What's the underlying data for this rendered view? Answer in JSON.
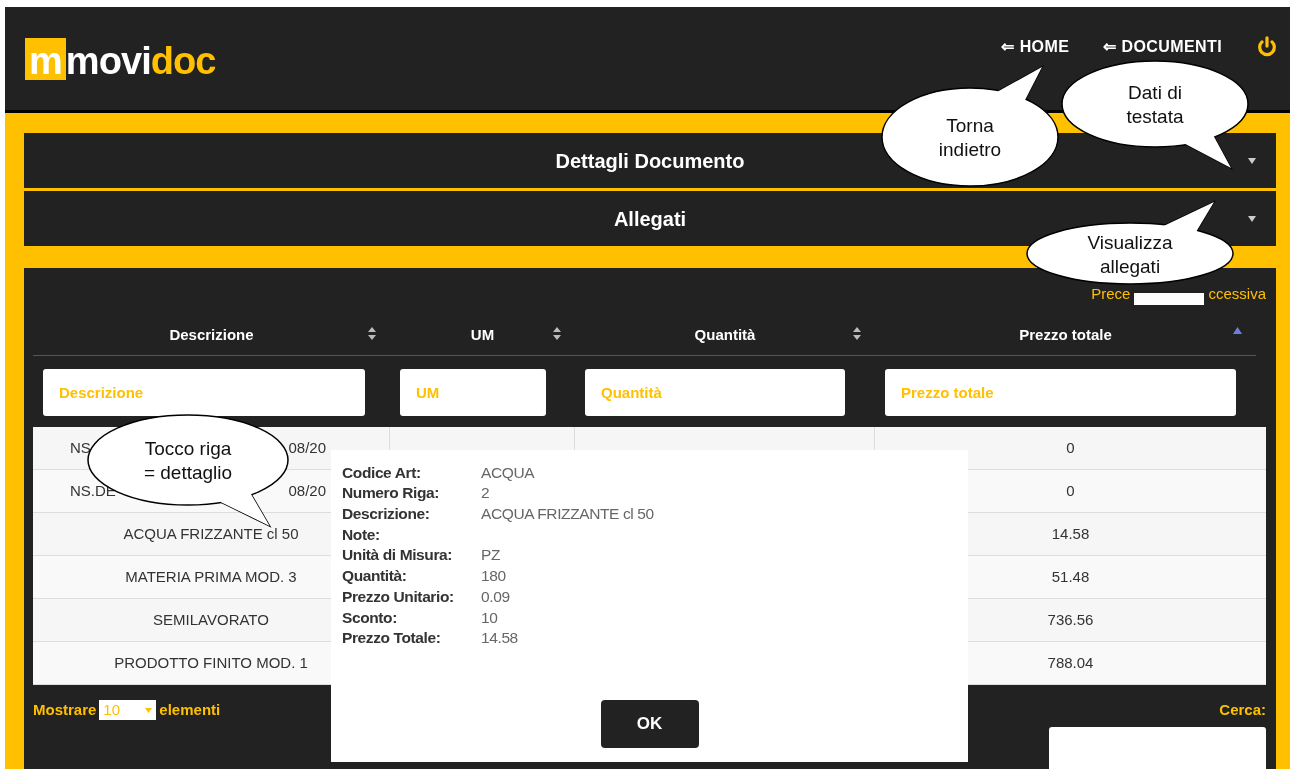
{
  "header": {
    "logo": {
      "mark": "m",
      "part1": "movi",
      "part2": "doc"
    },
    "nav": [
      {
        "kind": "link",
        "label": "⇐ HOME"
      },
      {
        "kind": "link",
        "label": "⇐ DOCUMENTI"
      },
      {
        "kind": "power"
      }
    ]
  },
  "accordions": [
    {
      "title": "Dettagli Documento",
      "expanded": false
    },
    {
      "title": "Allegati",
      "expanded": false
    }
  ],
  "pagination": {
    "previous": "Prece",
    "next": "ccessiva"
  },
  "table": {
    "columns": [
      {
        "label": "Descrizione",
        "sorted_ascending": false,
        "filter_placeholder": "Descrizione"
      },
      {
        "label": "UM",
        "sorted_ascending": false,
        "filter_placeholder": "UM"
      },
      {
        "label": "Quantità",
        "sorted_ascending": false,
        "filter_placeholder": "Quantità"
      },
      {
        "label": "Prezzo totale",
        "sorted_ascending": true,
        "filter_placeholder": "Prezzo totale"
      }
    ],
    "rows": [
      {
        "description": [
          "NS",
          "08/20"
        ],
        "total": "0"
      },
      {
        "description": [
          "NS.DE",
          "08/20"
        ],
        "total": "0"
      },
      {
        "description": [
          "ACQUA FRIZZANTE cl 50"
        ],
        "total": "14.58"
      },
      {
        "description": [
          "MATERIA PRIMA MOD. 3"
        ],
        "total": "51.48"
      },
      {
        "description": [
          "SEMILAVORATO"
        ],
        "total": "736.56"
      },
      {
        "description": [
          "PRODOTTO FINITO MOD. 1"
        ],
        "total": "788.04"
      }
    ]
  },
  "footer": {
    "show_before": "Mostrare",
    "page_size": "10",
    "show_after": "elementi",
    "search_label": "Cerca:"
  },
  "dialog": {
    "fields": [
      {
        "label": "Codice Art:",
        "value": "ACQUA"
      },
      {
        "label": "Numero Riga:",
        "value": "2"
      },
      {
        "label": "Descrizione:",
        "value": "ACQUA FRIZZANTE cl 50"
      },
      {
        "label": "Note:"
      },
      {
        "label": "Unità di Misura:",
        "value": "PZ"
      },
      {
        "label": "Quantità:",
        "value": "180"
      },
      {
        "label": "Prezzo Unitario:",
        "value": "0.09"
      },
      {
        "label": "Sconto:",
        "value": "10"
      },
      {
        "label": "Prezzo Totale:",
        "value": "14.58"
      }
    ],
    "button": "OK"
  },
  "callouts": [
    {
      "lines": [
        "Torna",
        "indietro"
      ]
    },
    {
      "lines": [
        "Dati di",
        "testata"
      ]
    },
    {
      "lines": [
        "Visualizza",
        "allegati"
      ]
    },
    {
      "lines": [
        "Tocco riga",
        "= dettaglio"
      ]
    }
  ]
}
